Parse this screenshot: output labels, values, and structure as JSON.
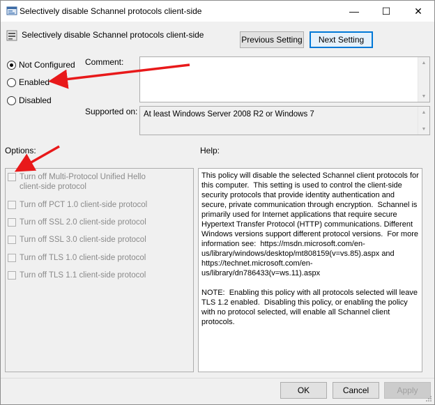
{
  "window": {
    "title": "Selectively disable Schannel protocols client-side",
    "controls": {
      "minimize": "—",
      "maximize": "☐",
      "close": "✕"
    }
  },
  "header": {
    "policy_name": "Selectively disable Schannel protocols client-side",
    "prev_label": "Previous Setting",
    "next_label": "Next Setting"
  },
  "state": {
    "options": [
      {
        "label": "Not Configured",
        "checked": true
      },
      {
        "label": "Enabled",
        "checked": false
      },
      {
        "label": "Disabled",
        "checked": false
      }
    ]
  },
  "comment": {
    "label": "Comment:",
    "value": ""
  },
  "supported": {
    "label": "Supported on:",
    "value": "At least Windows Server 2008 R2 or Windows 7"
  },
  "options_section": {
    "label": "Options:",
    "items": [
      {
        "label": "Turn off Multi-Protocol Unified Hello client-side protocol",
        "checked": false
      },
      {
        "label": "Turn off PCT 1.0 client-side protocol",
        "checked": false
      },
      {
        "label": "Turn off SSL 2.0 client-side protocol",
        "checked": false
      },
      {
        "label": "Turn off SSL 3.0 client-side protocol",
        "checked": false
      },
      {
        "label": "Turn off TLS 1.0 client-side protocol",
        "checked": false
      },
      {
        "label": "Turn off TLS 1.1 client-side protocol",
        "checked": false
      }
    ]
  },
  "help_section": {
    "label": "Help:",
    "text": "This policy will disable the selected Schannel client protocols for this computer.  This setting is used to control the client-side security protocols that provide identity authentication and secure, private communication through encryption.  Schannel is primarily used for Internet applications that require secure Hypertext Transfer Protocol (HTTP) communications. Different Windows versions support different protocol versions.  For more information see:  https://msdn.microsoft.com/en-us/library/windows/desktop/mt808159(v=vs.85).aspx and https://technet.microsoft.com/en-us/library/dn786433(v=ws.11).aspx\n\nNOTE:  Enabling this policy with all protocols selected will leave TLS 1.2 enabled.  Disabling this policy, or enabling the policy with no protocol selected, will enable all Schannel client protocols."
  },
  "footer": {
    "ok_label": "OK",
    "cancel_label": "Cancel",
    "apply_label": "Apply"
  },
  "colors": {
    "annotation_arrow": "#e8191a",
    "focus_border": "#0078d7"
  }
}
